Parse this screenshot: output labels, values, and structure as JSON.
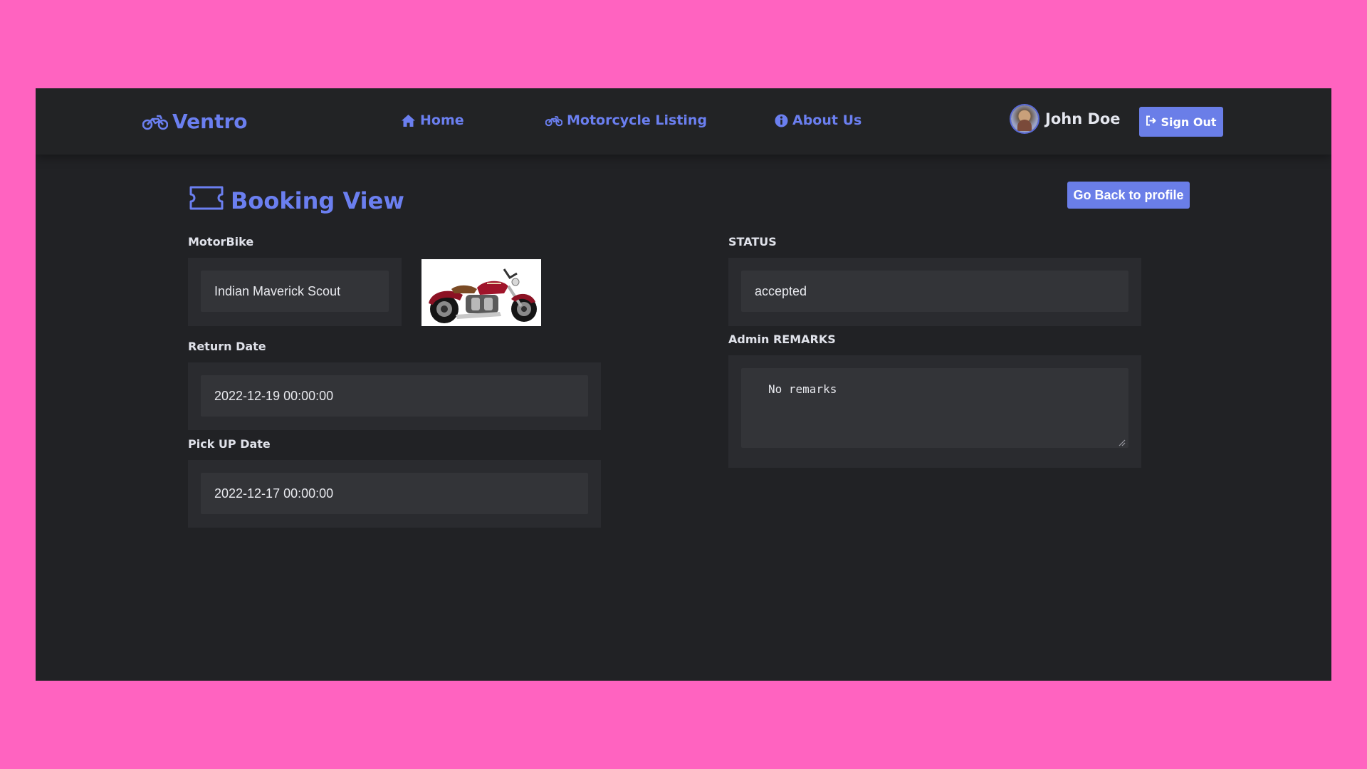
{
  "navbar": {
    "brand": "Ventro",
    "links": [
      {
        "label": "Home",
        "icon": "home-icon"
      },
      {
        "label": "Motorcycle Listing",
        "icon": "motorcycle-icon"
      },
      {
        "label": "About Us",
        "icon": "info-icon"
      }
    ],
    "user_name": "John Doe",
    "signout_label": "Sign Out"
  },
  "page": {
    "title": "Booking View",
    "back_button": "Go Back to profile"
  },
  "booking": {
    "motorbike_label": "MotorBike",
    "motorbike_value": "Indian Maverick Scout",
    "return_label": "Return Date",
    "return_value": "2022-12-19 00:00:00",
    "pickup_label": "Pick UP Date",
    "pickup_value": "2022-12-17 00:00:00",
    "status_label": "STATUS",
    "status_value": "accepted",
    "remarks_label": "Admin REMARKS",
    "remarks_value": "No remarks"
  },
  "colors": {
    "accent": "#6b7ff0",
    "button": "#6a7ee8",
    "background": "#212225",
    "page_frame": "#ff63c0"
  }
}
